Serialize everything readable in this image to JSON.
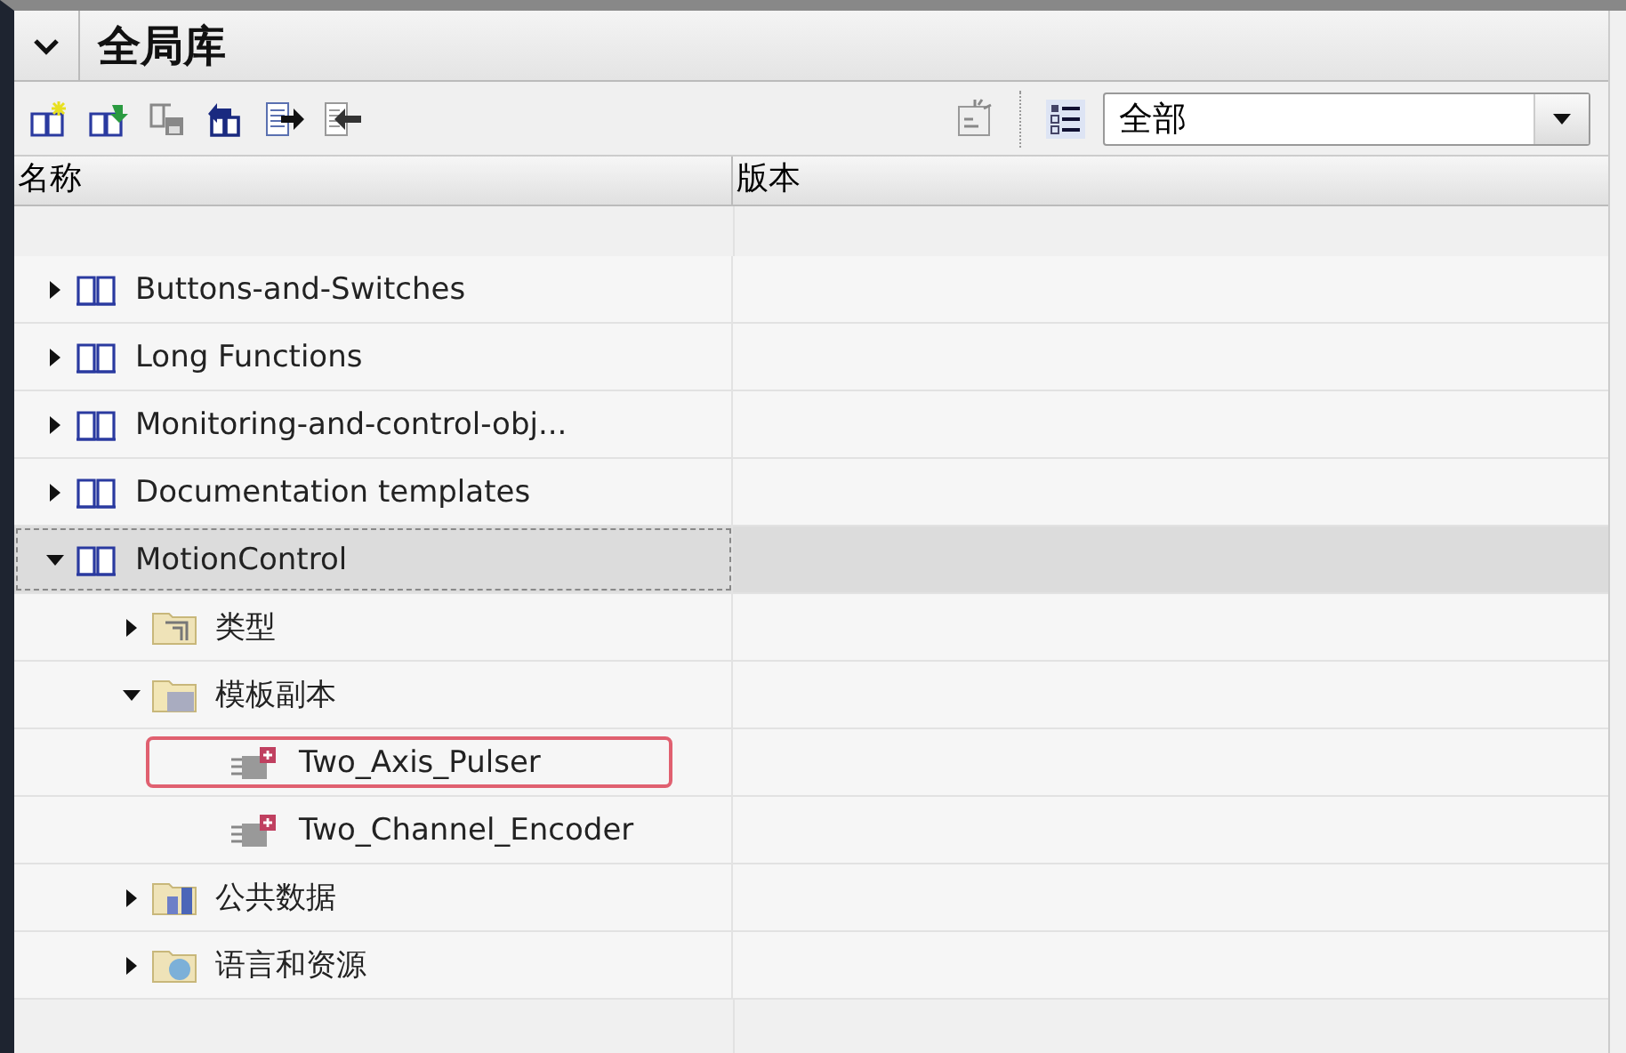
{
  "panel": {
    "title": "全局库",
    "expanded": true
  },
  "toolbar": {
    "filter": {
      "value": "全部"
    }
  },
  "columns": [
    "名称",
    "版本"
  ],
  "tree": [
    {
      "label": "Buttons-and-Switches",
      "kind": "library",
      "expanded": false,
      "selected": false
    },
    {
      "label": "Long Functions",
      "kind": "library",
      "expanded": false,
      "selected": false
    },
    {
      "label": "Monitoring-and-control-obj...",
      "kind": "library",
      "expanded": false,
      "selected": false
    },
    {
      "label": "Documentation templates",
      "kind": "library",
      "expanded": false,
      "selected": false
    },
    {
      "label": "MotionControl",
      "kind": "library",
      "expanded": true,
      "selected": true,
      "children": [
        {
          "label": "类型",
          "kind": "types",
          "expanded": false,
          "selected": false
        },
        {
          "label": "模板副本",
          "kind": "copies",
          "expanded": true,
          "selected": false,
          "children": [
            {
              "label": "Two_Axis_Pulser",
              "kind": "block",
              "selected": false,
              "marked": true
            },
            {
              "label": "Two_Channel_Encoder",
              "kind": "block",
              "selected": false,
              "marked": false
            }
          ]
        },
        {
          "label": "公共数据",
          "kind": "common",
          "expanded": false,
          "selected": false
        },
        {
          "label": "语言和资源",
          "kind": "languages",
          "expanded": false,
          "selected": false
        }
      ]
    }
  ]
}
